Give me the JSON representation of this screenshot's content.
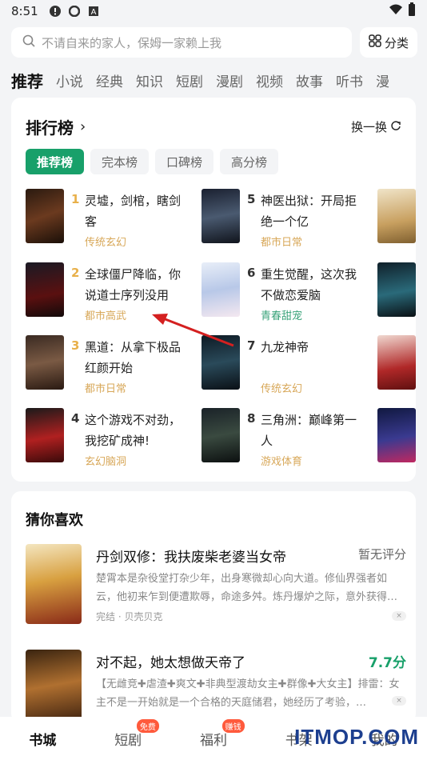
{
  "status_bar": {
    "time": "8:51"
  },
  "search": {
    "placeholder": "不请自来的家人，保姆一家赖上我",
    "category_label": "分类"
  },
  "channels": [
    "推荐",
    "小说",
    "经典",
    "知识",
    "短剧",
    "漫剧",
    "视频",
    "故事",
    "听书",
    "漫"
  ],
  "ranking": {
    "title": "排行榜",
    "swap_label": "换一换",
    "tabs": [
      "推荐榜",
      "完本榜",
      "口碑榜",
      "高分榜"
    ],
    "items": [
      {
        "rank": "1",
        "title": "灵墟，剑棺，瞎剑客",
        "genre": "传统玄幻"
      },
      {
        "rank": "2",
        "title": "全球僵尸降临，你说道士序列没用",
        "genre": "都市高武"
      },
      {
        "rank": "3",
        "title": "黑道：从拿下极品红颜开始",
        "genre": "都市日常"
      },
      {
        "rank": "4",
        "title": "这个游戏不对劲，我挖矿成神!",
        "genre": "玄幻脑洞"
      },
      {
        "rank": "5",
        "title": "神医出狱：开局拒绝一个亿",
        "genre": "都市日常"
      },
      {
        "rank": "6",
        "title": "重生觉醒，这次我不做恋爱脑",
        "genre": "青春甜宠"
      },
      {
        "rank": "7",
        "title": "九龙神帝",
        "genre": "传统玄幻"
      },
      {
        "rank": "8",
        "title": "三角洲：巅峰第一人",
        "genre": "游戏体育"
      }
    ]
  },
  "guess": {
    "title": "猜你喜欢",
    "books": [
      {
        "title": "丹剑双修：我扶废柴老婆当女帝",
        "score": "暂无评分",
        "desc": "楚霄本是杂役堂打杂少年，出身寒微却心向大道。修仙界强者如云，他初来乍到便遭欺辱，命途多舛。炼丹爆炉之际，意外获得…",
        "meta": "完结 · 贝壳贝克"
      },
      {
        "title": "对不起，她太想做天帝了",
        "score": "7.7分",
        "desc": "【无雌竞✚虐渣✚爽文✚非典型渡劫女主✚群像✚大女主】排雷：女主不是一开始就是一个合格的天庭储君，她经历了考验，…",
        "meta": ""
      }
    ]
  },
  "bottom_nav": {
    "items": [
      "书城",
      "短剧",
      "福利",
      "书架",
      "我的"
    ],
    "badge_short": "免费",
    "badge_welfare": "赚钱"
  },
  "watermark": "ITMOP.COM",
  "colors": {
    "accent": "#18a06a",
    "rank_top": "#e8b04a",
    "genre": "#d8a85a",
    "genre_alt": "#3aa37a"
  }
}
